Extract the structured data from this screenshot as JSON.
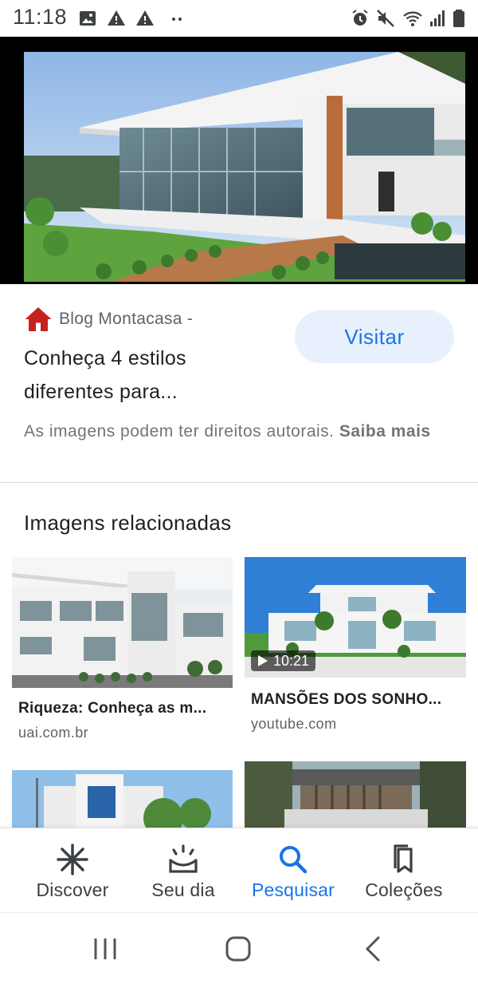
{
  "status_bar": {
    "time": "11:18",
    "icons": [
      "image-icon",
      "warning-icon",
      "warning-icon",
      "more-dots-icon",
      "alarm-icon",
      "mute-icon",
      "wifi-icon",
      "signal-icon",
      "battery-icon"
    ]
  },
  "result": {
    "site_name": "Blog Montacasa -",
    "title_line1": "Conheça 4 estilos",
    "title_line2": "diferentes para...",
    "visit_label": "Visitar",
    "rights_text": "As imagens podem ter direitos autorais.",
    "rights_link": "Saiba mais"
  },
  "related": {
    "heading": "Imagens relacionadas",
    "items": [
      {
        "title": "Riqueza: Conheça as m...",
        "source": "uai.com.br"
      },
      {
        "title": "MANSÕES DOS SONHO...",
        "source": "youtube.com",
        "duration": "10:21"
      },
      {
        "title": "",
        "source": ""
      },
      {
        "title": "",
        "source": ""
      }
    ]
  },
  "bottom_nav": {
    "items": [
      {
        "label": "Discover",
        "icon": "asterisk-icon"
      },
      {
        "label": "Seu dia",
        "icon": "sunrise-icon"
      },
      {
        "label": "Pesquisar",
        "icon": "search-icon",
        "active": true
      },
      {
        "label": "Coleções",
        "icon": "bookmark-copy-icon"
      }
    ]
  },
  "colors": {
    "accent": "#1a73e8",
    "visit_bg": "#e8f0fe",
    "site_icon": "#c5221f"
  }
}
